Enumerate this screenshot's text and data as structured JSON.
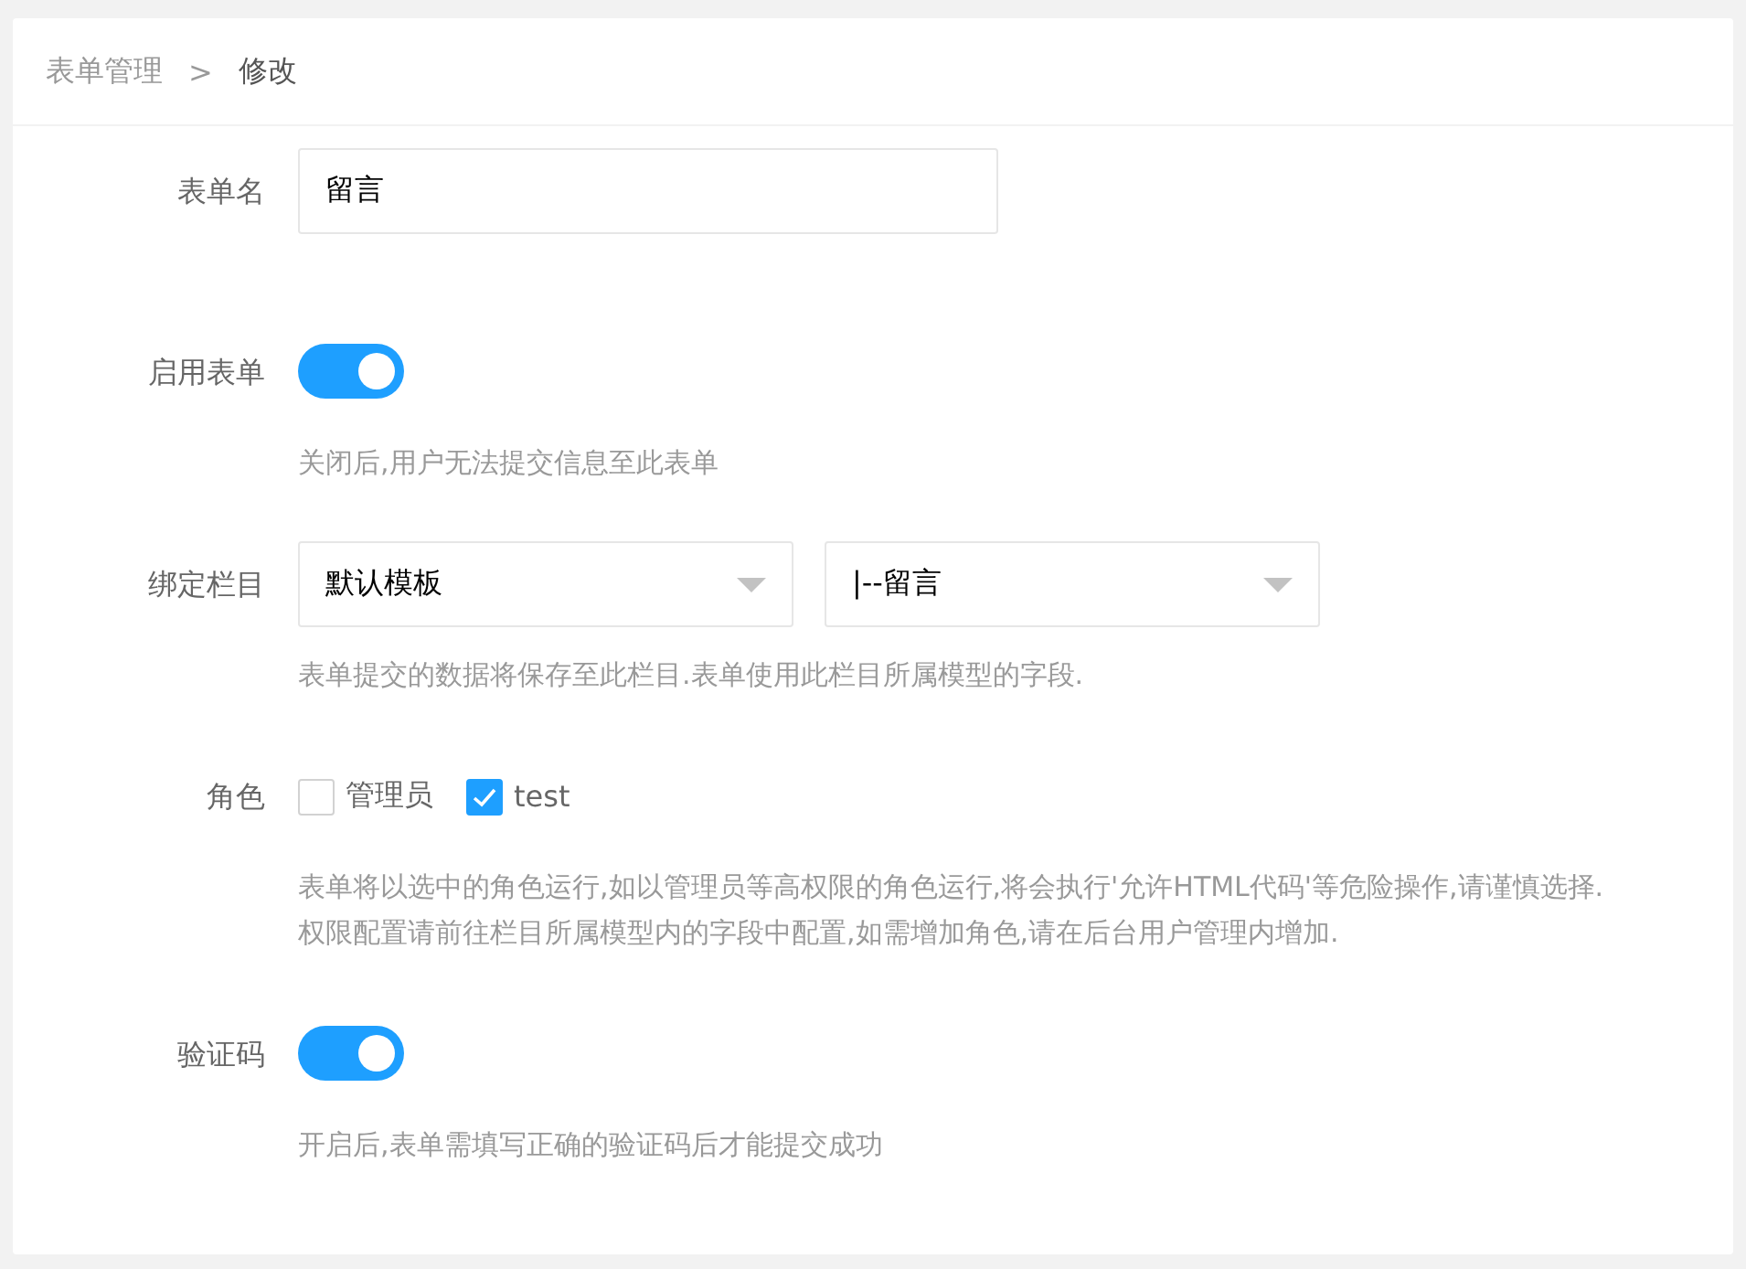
{
  "breadcrumb": [
    {
      "label": "表单管理",
      "selected": false
    },
    {
      "label": "修改",
      "selected": true
    }
  ],
  "breadcrumb_separator": ">",
  "fields": [
    {
      "kind": "text",
      "label": "表单名",
      "value": "留言"
    },
    {
      "kind": "switch",
      "label": "启用表单",
      "on": true,
      "hint": "关闭后,用户无法提交信息至此表单"
    },
    {
      "kind": "selects",
      "label": "绑定栏目",
      "selects": [
        {
          "value": "默认模板"
        },
        {
          "value": "|--留言"
        }
      ],
      "hint": "表单提交的数据将保存至此栏目.表单使用此栏目所属模型的字段."
    },
    {
      "kind": "checkboxes",
      "label": "角色",
      "options": [
        {
          "label": "管理员",
          "checked": false
        },
        {
          "label": "test",
          "checked": true
        }
      ],
      "hint": "表单将以选中的角色运行,如以管理员等高权限的角色运行,将会执行'允许HTML代码'等危险操作,请谨慎选择.\n权限配置请前往栏目所属模型内的字段中配置,如需增加角色,请在后台用户管理内增加."
    },
    {
      "kind": "switch",
      "label": "验证码",
      "on": true,
      "hint": "开启后,表单需填写正确的验证码后才能提交成功"
    }
  ]
}
